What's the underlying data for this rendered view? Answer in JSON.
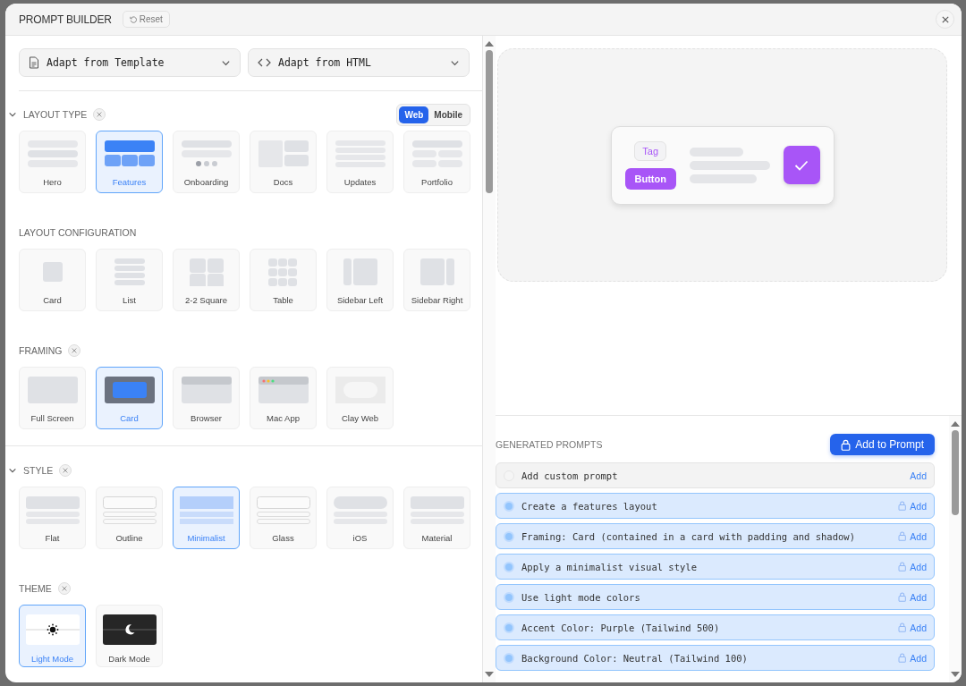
{
  "header": {
    "title": "PROMPT BUILDER",
    "reset": "Reset"
  },
  "sources": [
    {
      "label": "Adapt from Template",
      "kind": "template"
    },
    {
      "label": "Adapt from HTML",
      "kind": "html"
    }
  ],
  "sections": [
    {
      "title": "LAYOUT TYPE",
      "expanded": true,
      "clear": {
        "kind": "x"
      },
      "platforms": [
        {
          "label": "Web",
          "selected": true
        },
        {
          "label": "Mobile",
          "selected": false
        }
      ],
      "options": [
        {
          "label": "Hero",
          "kind": "hero",
          "selected": false
        },
        {
          "label": "Features",
          "kind": "features",
          "selected": true
        },
        {
          "label": "Onboarding",
          "kind": "onboarding",
          "selected": false
        },
        {
          "label": "Docs",
          "kind": "docs",
          "selected": false
        },
        {
          "label": "Updates",
          "kind": "updates",
          "selected": false
        },
        {
          "label": "Portfolio",
          "kind": "portfolio",
          "selected": false
        }
      ]
    },
    {
      "title": "LAYOUT CONFIGURATION",
      "options": [
        {
          "label": "Card",
          "kind": "single",
          "selected": false
        },
        {
          "label": "List",
          "kind": "list",
          "selected": false
        },
        {
          "label": "2-2 Square",
          "kind": "grid",
          "selected": false
        },
        {
          "label": "Table",
          "kind": "table",
          "selected": false
        },
        {
          "label": "Sidebar Left",
          "kind": "sidebar-left",
          "selected": false
        },
        {
          "label": "Sidebar Right",
          "kind": "sidebar-right",
          "selected": false
        }
      ]
    },
    {
      "title": "FRAMING",
      "clear": {
        "kind": "x"
      },
      "options": [
        {
          "label": "Full Screen",
          "kind": "fullscreen",
          "selected": false
        },
        {
          "label": "Card",
          "kind": "framed",
          "selected": true
        },
        {
          "label": "Browser",
          "kind": "browser",
          "selected": false
        },
        {
          "label": "Mac App",
          "kind": "mac",
          "selected": false
        },
        {
          "label": "Clay Web",
          "kind": "clay",
          "selected": false
        }
      ]
    },
    {
      "title": "STYLE",
      "expanded": true,
      "clear": {
        "kind": "x"
      },
      "options": [
        {
          "label": "Flat",
          "kind": "flat",
          "selected": false
        },
        {
          "label": "Outline",
          "kind": "outline",
          "selected": false
        },
        {
          "label": "Minimalist",
          "kind": "minimalist",
          "selected": true
        },
        {
          "label": "Glass",
          "kind": "glass",
          "selected": false
        },
        {
          "label": "iOS",
          "kind": "ios",
          "selected": false
        },
        {
          "label": "Material",
          "kind": "material",
          "selected": false
        }
      ]
    },
    {
      "title": "THEME",
      "clear": {
        "kind": "x"
      },
      "options": [
        {
          "label": "Light Mode",
          "kind": "light",
          "selected": true
        },
        {
          "label": "Dark Mode",
          "kind": "dark",
          "selected": false
        }
      ]
    }
  ],
  "preview": {
    "tag": "Tag",
    "button": "Button"
  },
  "prompts": {
    "title": "GENERATED PROMPTS",
    "add_button": "Add to Prompt",
    "items": [
      {
        "text": "Add custom prompt",
        "action": "Add",
        "active": false
      },
      {
        "text": "Create a features layout",
        "action": "Add",
        "active": true
      },
      {
        "text": "Framing: Card (contained in a card with padding and shadow)",
        "action": "Add",
        "active": true
      },
      {
        "text": "Apply a minimalist visual style",
        "action": "Add",
        "active": true
      },
      {
        "text": "Use light mode colors",
        "action": "Add",
        "active": true
      },
      {
        "text": "Accent Color: Purple (Tailwind 500)",
        "action": "Add",
        "active": true
      },
      {
        "text": "Background Color: Neutral (Tailwind 100)",
        "action": "Add",
        "active": true
      }
    ]
  }
}
